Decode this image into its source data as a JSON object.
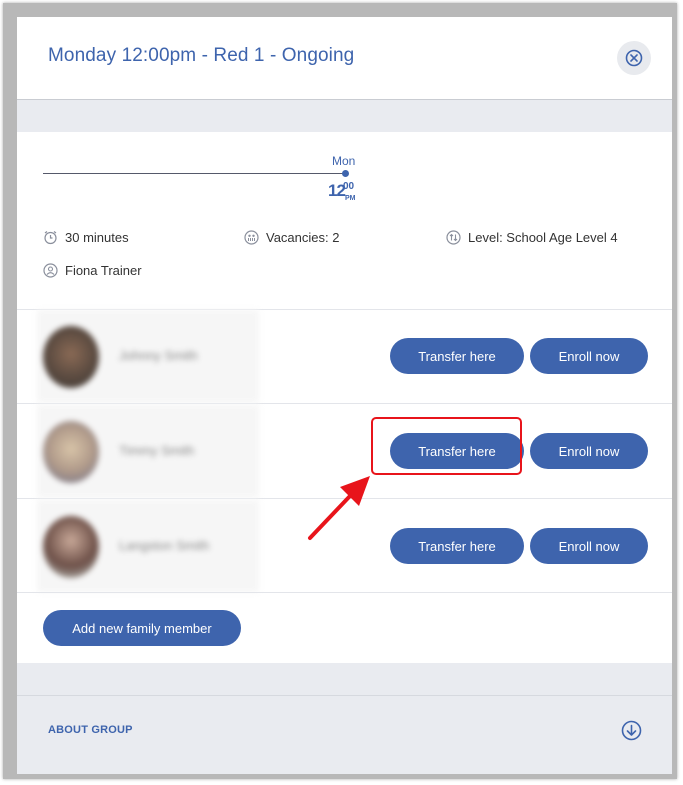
{
  "modal": {
    "title": "Monday 12:00pm - Red 1 - Ongoing",
    "close_icon": "close-circle-icon"
  },
  "timeline": {
    "day": "Mon",
    "hour": "12",
    "minutes": "00",
    "ampm": "PM"
  },
  "details": {
    "duration": "30 minutes",
    "vacancies": "Vacancies: 2",
    "level": "Level: School Age Level 4",
    "trainer": "Fiona Trainer"
  },
  "family_members": [
    {
      "name": "Johnny Smith",
      "transfer_label": "Transfer here",
      "enroll_label": "Enroll now"
    },
    {
      "name": "Timmy Smith",
      "transfer_label": "Transfer here",
      "enroll_label": "Enroll now"
    },
    {
      "name": "Langston Smith",
      "transfer_label": "Transfer here",
      "enroll_label": "Enroll now"
    }
  ],
  "add_member_label": "Add new family member",
  "about": {
    "label": "ABOUT GROUP",
    "icon": "arrow-down-circle-icon"
  },
  "colors": {
    "accent": "#3e64ad",
    "band": "#e9ebf0",
    "highlight": "#e8141b"
  }
}
